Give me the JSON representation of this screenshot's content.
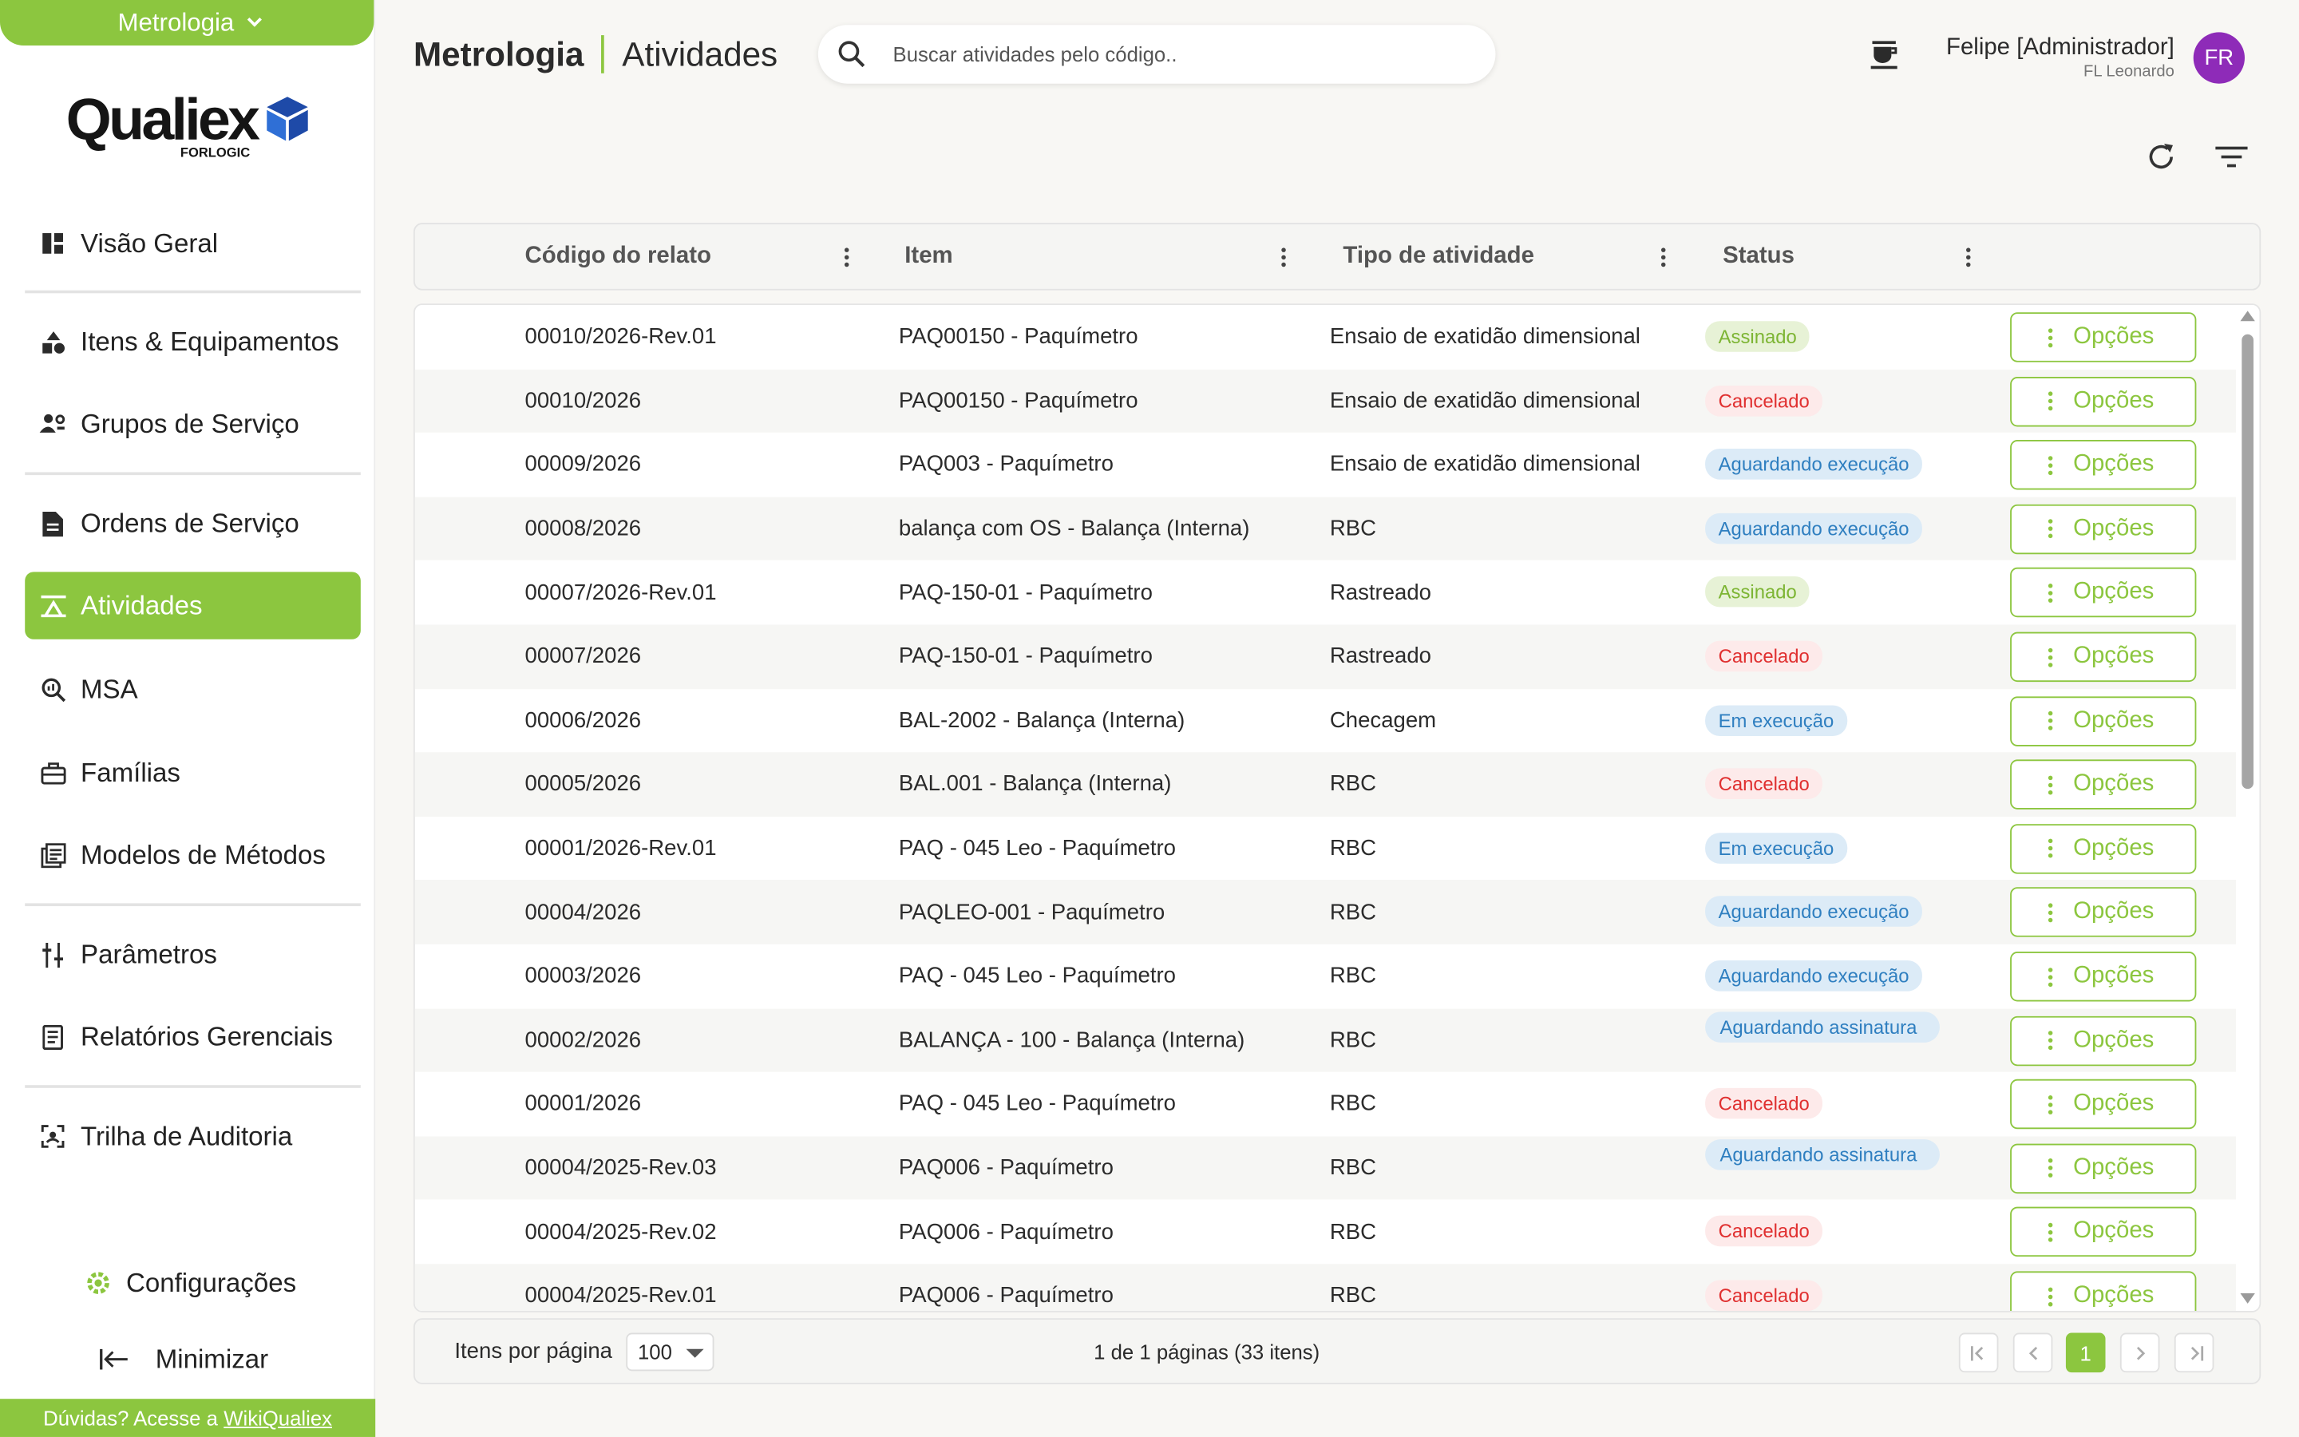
{
  "sidebar": {
    "module": "Metrologia",
    "logo_text": "Qualiex",
    "logo_sub": "FORLOGIC",
    "items": [
      {
        "label": "Visão Geral",
        "icon": "dashboard-icon"
      },
      {
        "label": "Itens & Equipamentos",
        "icon": "shapes-icon"
      },
      {
        "label": "Grupos de Serviço",
        "icon": "users-gear-icon"
      },
      {
        "label": "Ordens de Serviço",
        "icon": "document-icon"
      },
      {
        "label": "Atividades",
        "icon": "activity-icon"
      },
      {
        "label": "MSA",
        "icon": "magnifier-chart-icon"
      },
      {
        "label": "Famílias",
        "icon": "toolbox-icon"
      },
      {
        "label": "Modelos de Métodos",
        "icon": "library-icon"
      },
      {
        "label": "Parâmetros",
        "icon": "sliders-icon"
      },
      {
        "label": "Relatórios Gerenciais",
        "icon": "report-icon"
      },
      {
        "label": "Trilha de Auditoria",
        "icon": "audit-scan-icon"
      }
    ],
    "settings_label": "Configurações",
    "minimize_label": "Minimizar",
    "help_text": "Dúvidas? Acesse a",
    "help_link": "WikiQualiex"
  },
  "header": {
    "module": "Metrologia",
    "page": "Atividades",
    "search_placeholder": "Buscar atividades pelo código..",
    "user_name": "Felipe [Administrador]",
    "user_org": "FL Leonardo",
    "avatar_initials": "FR"
  },
  "table": {
    "columns": [
      "Código do relato",
      "Item",
      "Tipo de atividade",
      "Status"
    ],
    "option_label": "Opções",
    "rows": [
      {
        "code": "00010/2026-Rev.01",
        "item": "PAQ00150 - Paquímetro",
        "type": "Ensaio de exatidão dimensional",
        "status": "Assinado",
        "kind": "assinado"
      },
      {
        "code": "00010/2026",
        "item": "PAQ00150 - Paquímetro",
        "type": "Ensaio de exatidão dimensional",
        "status": "Cancelado",
        "kind": "cancelado"
      },
      {
        "code": "00009/2026",
        "item": "PAQ003 - Paquímetro",
        "type": "Ensaio de exatidão dimensional",
        "status": "Aguardando execução",
        "kind": "aguardando"
      },
      {
        "code": "00008/2026",
        "item": "balança com OS - Balança (Interna)",
        "type": "RBC",
        "status": "Aguardando execução",
        "kind": "aguardando"
      },
      {
        "code": "00007/2026-Rev.01",
        "item": "PAQ-150-01 - Paquímetro",
        "type": "Rastreado",
        "status": "Assinado",
        "kind": "assinado"
      },
      {
        "code": "00007/2026",
        "item": "PAQ-150-01 - Paquímetro",
        "type": "Rastreado",
        "status": "Cancelado",
        "kind": "cancelado"
      },
      {
        "code": "00006/2026",
        "item": "BAL-2002 - Balança (Interna)",
        "type": "Checagem",
        "status": "Em execução",
        "kind": "execucao"
      },
      {
        "code": "00005/2026",
        "item": "BAL.001 - Balança (Interna)",
        "type": "RBC",
        "status": "Cancelado",
        "kind": "cancelado"
      },
      {
        "code": "00001/2026-Rev.01",
        "item": "PAQ - 045 Leo - Paquímetro",
        "type": "RBC",
        "status": "Em execução",
        "kind": "execucao"
      },
      {
        "code": "00004/2026",
        "item": "PAQLEO-001 - Paquímetro",
        "type": "RBC",
        "status": "Aguardando execução",
        "kind": "aguardando"
      },
      {
        "code": "00003/2026",
        "item": "PAQ - 045 Leo - Paquímetro",
        "type": "RBC",
        "status": "Aguardando execução",
        "kind": "aguardando"
      },
      {
        "code": "00002/2026",
        "item": "BALANÇA - 100 - Balança (Interna)",
        "type": "RBC",
        "status": "Aguardando assinatura",
        "kind": "aguardando wide"
      },
      {
        "code": "00001/2026",
        "item": "PAQ - 045 Leo - Paquímetro",
        "type": "RBC",
        "status": "Cancelado",
        "kind": "cancelado"
      },
      {
        "code": "00004/2025-Rev.03",
        "item": "PAQ006 - Paquímetro",
        "type": "RBC",
        "status": "Aguardando assinatura",
        "kind": "aguardando wide"
      },
      {
        "code": "00004/2025-Rev.02",
        "item": "PAQ006 - Paquímetro",
        "type": "RBC",
        "status": "Cancelado",
        "kind": "cancelado"
      },
      {
        "code": "00004/2025-Rev.01",
        "item": "PAQ006 - Paquímetro",
        "type": "RBC",
        "status": "Cancelado",
        "kind": "cancelado"
      }
    ]
  },
  "pagination": {
    "per_page_label": "Itens por página",
    "per_page_value": "100",
    "info": "1 de 1 páginas (33 itens)",
    "current_page": "1"
  },
  "colors": {
    "accent": "#8cc63f",
    "avatar": "#8e2bb8",
    "cancel": "#e03030",
    "info": "#2f7fc0"
  }
}
